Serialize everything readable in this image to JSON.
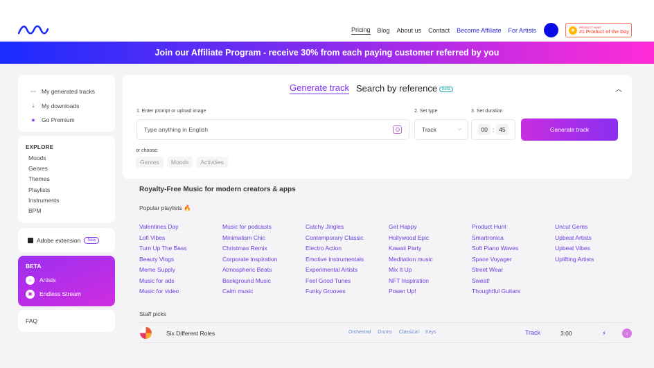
{
  "header": {
    "nav": [
      "Pricing",
      "Blog",
      "About us",
      "Contact",
      "Become Affiliate",
      "For Artists"
    ],
    "ph_badge_small": "PRODUCT HUNT",
    "ph_badge_big": "#1 Product of the Day"
  },
  "banner": {
    "text": "Join our Affiliate Program - receive 30% from each paying customer referred by you"
  },
  "sidebar": {
    "top_items": [
      {
        "label": "My generated tracks",
        "icon": "wave-icon"
      },
      {
        "label": "My downloads",
        "icon": "download-icon"
      },
      {
        "label": "Go Premium",
        "icon": "star-icon"
      }
    ],
    "explore_title": "EXPLORE",
    "explore_items": [
      "Moods",
      "Genres",
      "Themes",
      "Playlists",
      "Instruments",
      "BPM"
    ],
    "extension_label": "Adobe extension",
    "extension_badge": "New",
    "beta_title": "BETA",
    "beta_items": [
      "Artists",
      "Endless Stream"
    ],
    "faq": "FAQ"
  },
  "search": {
    "tab_generate": "Generate track",
    "tab_reference": "Search by reference",
    "tab_reference_badge": "beta",
    "label_prompt": "1. Enter prompt or upload image",
    "label_type": "2. Set type",
    "label_duration": "3. Set duration",
    "prompt_placeholder": "Type anything in English",
    "type_value": "Track",
    "duration_min": "00",
    "duration_sep": ":",
    "duration_sec": "45",
    "generate_button": "Generate track",
    "or_choose": "or choose:",
    "chips": [
      "Genres",
      "Moods",
      "Activities"
    ]
  },
  "content": {
    "title": "Royalty-Free Music for modern creators & apps",
    "popular_label": "Popular playlists 🔥",
    "playlists": [
      "Valentines Day",
      "Music for podcasts",
      "Catchy Jingles",
      "Get Happy",
      "Product Hunt",
      "Uncut Gems",
      "Lofi Vibes",
      "Minimalism Chic",
      "Contemporary Classic",
      "Hollywood Epic",
      "Smartronica",
      "Upbeat Artists",
      "Turn Up The Bass",
      "Christmas Remix",
      "Electro Action",
      "Kawaii Party",
      "Soft Piano Waves",
      "Upbeat Vibes",
      "Beauty Vlogs",
      "Corporate Inspiration",
      "Emotive Instrumentals",
      "Meditation music",
      "Space Voyager",
      "Uplifting Artists",
      "Meme Supply",
      "Atmospheric Beats",
      "Experimental Artists",
      "Mix It Up",
      "Street Wear",
      "",
      "Music for ads",
      "Background Music",
      "Feel Good Tunes",
      "NFT Inspiration",
      "Sweat!",
      "",
      "Music for video",
      "Calm music",
      "Funky Grooves",
      "Power Up!",
      "Thoughtful Guitars",
      ""
    ],
    "staff_label": "Staff picks",
    "track": {
      "name": "Six Different Roles",
      "tags": [
        "Orchestral",
        "Drums",
        "Classical",
        "Keys"
      ],
      "type": "Track",
      "duration": "3:00"
    }
  },
  "colors": {
    "accent": "#7b2cf0",
    "link": "#6b3be0",
    "avatar": "#0a0ae8"
  }
}
